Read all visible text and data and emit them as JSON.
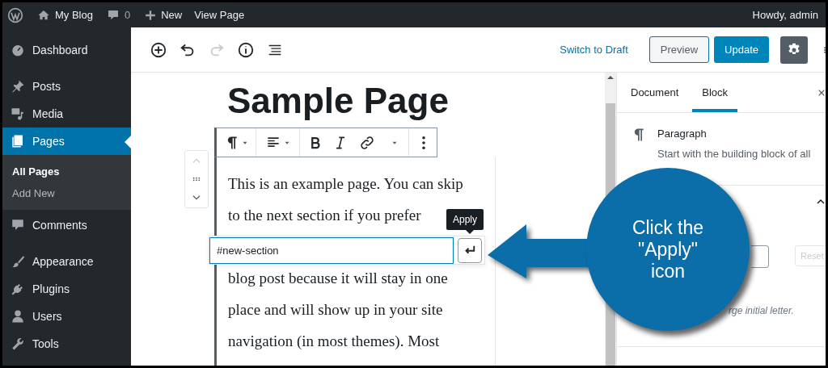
{
  "admin_bar": {
    "site": "My Blog",
    "comments": "0",
    "new": "New",
    "view": "View Page",
    "greeting": "Howdy, admin"
  },
  "menu": [
    {
      "label": "Dashboard",
      "selected": false
    },
    {
      "label": "Posts",
      "selected": false
    },
    {
      "label": "Media",
      "selected": false
    },
    {
      "label": "Pages",
      "selected": true,
      "children": [
        {
          "label": "All Pages",
          "selected": true
        },
        {
          "label": "Add New",
          "selected": false
        }
      ]
    },
    {
      "label": "Comments",
      "selected": false
    },
    {
      "label": "Appearance",
      "selected": false
    },
    {
      "label": "Plugins",
      "selected": false
    },
    {
      "label": "Users",
      "selected": false
    },
    {
      "label": "Tools",
      "selected": false
    }
  ],
  "editor_toolbar": {
    "tools": [
      {
        "disabled": false
      },
      {
        "disabled": false
      },
      {
        "disabled": true
      },
      {
        "disabled": false
      },
      {
        "disabled": false
      }
    ],
    "switch_to_draft": "Switch to Draft",
    "preview": "Preview",
    "update": "Update",
    "settings_pressed": true
  },
  "title": "Sample Page",
  "paragraph": {
    "lines_above": [
      "This is an example page. You can skip",
      "to the next section if you prefer"
    ],
    "lines_below": [
      "blog post because it will stay in one",
      "place and will show up in your site",
      "navigation (in most themes). Most"
    ]
  },
  "link_popover": {
    "value": "#new-section",
    "tooltip": "Apply"
  },
  "inspector": {
    "tabs": [
      {
        "label": "Document",
        "selected": false
      },
      {
        "label": "Block",
        "selected": true
      }
    ],
    "block_name": "Paragraph",
    "block_description": "Start with the building block of all",
    "reset": {
      "label": "Reset",
      "disabled": true
    },
    "hint": "rge initial letter."
  },
  "callout": {
    "lines": [
      "Click the",
      "\"Apply\"",
      "icon"
    ]
  }
}
